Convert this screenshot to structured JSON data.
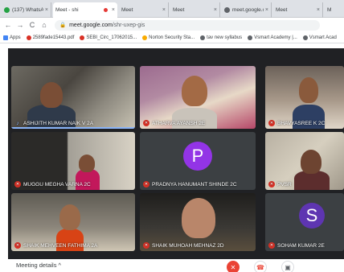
{
  "browser": {
    "tabs": [
      {
        "label": "(137) WhatsAp",
        "icon": "whatsapp-icon"
      },
      {
        "label": "Meet - shi",
        "icon": "meet-icon",
        "recording": true,
        "active": true
      },
      {
        "label": "Meet",
        "icon": "meet-icon"
      },
      {
        "label": "Meet",
        "icon": "meet-icon"
      },
      {
        "label": "meet.google.c",
        "icon": "globe-icon"
      },
      {
        "label": "Meet",
        "icon": "meet-icon"
      },
      {
        "label": "M",
        "icon": "meet-icon"
      }
    ],
    "address": {
      "host": "meet.google.com",
      "path": "/shr-uxep-gis"
    },
    "bookmarks": [
      {
        "label": "Apps",
        "color": "#4285f4"
      },
      {
        "label": "2589fade15443.pdf",
        "color": "#d93025"
      },
      {
        "label": "SEBI_Circ_17062015...",
        "color": "#d93025"
      },
      {
        "label": "Norton Security Sta...",
        "color": "#f9ab00"
      },
      {
        "label": "tav new syllabus",
        "color": "#5f6368"
      },
      {
        "label": "Vsmart Academy |...",
        "color": "#5f6368"
      },
      {
        "label": "Vsmart Acad",
        "color": "#5f6368"
      }
    ]
  },
  "meet": {
    "participants": [
      {
        "name": "ASHIJITH KUMAR NAIK V 2A",
        "mic": "on",
        "speaking": true
      },
      {
        "name": "ATHARVA AYANSH 2E",
        "mic": "muted"
      },
      {
        "name": "BHAVYASREE K 2C",
        "mic": "muted"
      },
      {
        "name": "MUGGU MEGHA VARNA 2C",
        "mic": "muted"
      },
      {
        "name": "PRADNYA HANUMANT SHINDE 2C",
        "mic": "muted",
        "avatar_letter": "P",
        "avatar_color": "#9334e6"
      },
      {
        "name": "PVSR",
        "mic": "muted"
      },
      {
        "name": "SHAIK MEHVEEN FATHIMA 2A",
        "mic": "muted"
      },
      {
        "name": "SHAIK MUHOAH MEHNAZ 2D",
        "mic": "muted"
      },
      {
        "name": "SOHAM KUMAR 2E",
        "mic": "muted",
        "avatar_letter": "S",
        "avatar_color": "#5e35b1"
      }
    ],
    "footer": {
      "details_label": "Meeting details ^"
    },
    "colors": {
      "stage": "#202124",
      "muted": "#d93025",
      "end_call": "#ea4335"
    }
  }
}
